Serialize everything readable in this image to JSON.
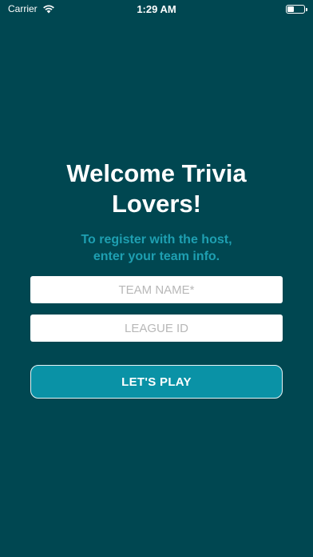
{
  "status_bar": {
    "carrier": "Carrier",
    "time": "1:29 AM",
    "wifi_icon": "wifi-icon",
    "battery_icon": "battery-icon"
  },
  "main": {
    "title": "Welcome Trivia Lovers!",
    "subtitle": "To register with the host, enter your team info.",
    "team_name_placeholder": "TEAM NAME*",
    "team_name_value": "",
    "league_id_placeholder": "LEAGUE ID",
    "league_id_value": "",
    "play_button_label": "LET'S PLAY"
  },
  "colors": {
    "background": "#004751",
    "accent_text": "#1e9fb1",
    "button": "#0a92a6"
  }
}
